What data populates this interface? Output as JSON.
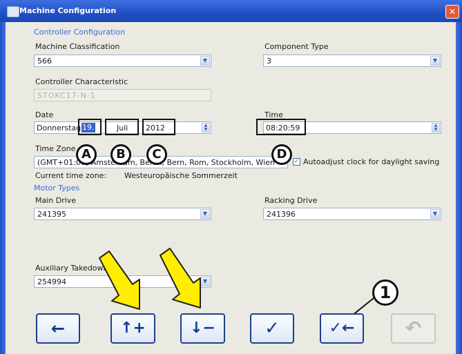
{
  "window": {
    "title": "Machine Configuration",
    "close_glyph": "✕",
    "app_icon": "app-window-icon"
  },
  "controller_group": "Controller Configuration",
  "machine_classification": {
    "label": "Machine Classification",
    "value": "566"
  },
  "component_type": {
    "label": "Component Type",
    "value": "3"
  },
  "controller_characteristic": {
    "label": "Controller Characteristic",
    "value": "STOKC17-N-1"
  },
  "date": {
    "label": "Date",
    "weekday": "Donnerstag,",
    "day": "19.",
    "month": "Juli",
    "year": "2012"
  },
  "time": {
    "label": "Time",
    "value": "08:20:59"
  },
  "time_zone": {
    "label": "Time Zone",
    "value": "(GMT+01:00) Amsterdam, Berlin, Bern, Rom, Stockholm, Wien",
    "autoadjust_label": "Autoadjust clock for daylight saving",
    "autoadjust_checked": true,
    "current_label": "Current time zone:",
    "current_value": "Westeuropäische Sommerzeit"
  },
  "motor_group": "Motor Types",
  "main_drive": {
    "label": "Main Drive",
    "value": "241395"
  },
  "racking_drive": {
    "label": "Racking Drive",
    "value": "241396"
  },
  "auxiliary": {
    "label": "Auxiliary Takedown",
    "value": "254994"
  },
  "callouts": {
    "a": "A",
    "b": "B",
    "c": "C",
    "d": "D",
    "one": "1"
  },
  "toolbar": {
    "back": "←",
    "increase": "↑+",
    "decrease": "↓−",
    "confirm": "✓",
    "confirm_back": "✓←",
    "undo": "↶"
  },
  "colors": {
    "accent": "#3a6bd6",
    "arrow_yellow": "#ffee00",
    "button_border": "#1d3f8c"
  }
}
